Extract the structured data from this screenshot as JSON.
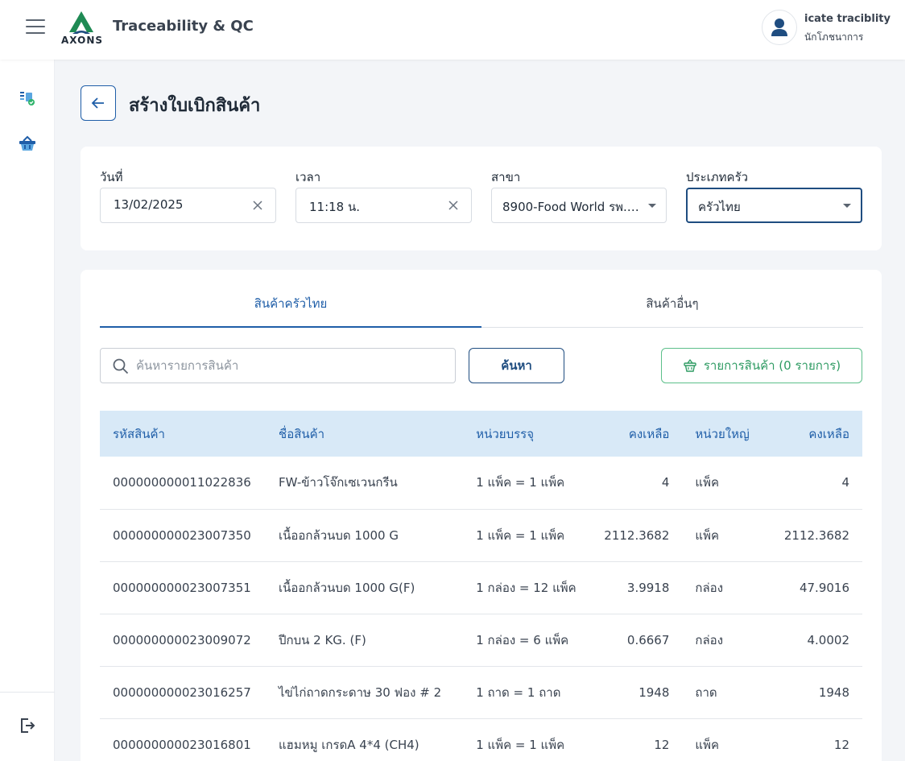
{
  "header": {
    "logo_text": "AXONS",
    "app_title": "Traceability & QC",
    "user_name": "icate traciblity",
    "user_role": "นักโภชนาการ"
  },
  "sidebar": {
    "items": [
      {
        "icon": "document-check-icon"
      },
      {
        "icon": "basket-icon"
      }
    ],
    "logout_icon": "logout-icon"
  },
  "page": {
    "title": "สร้างใบเบิกสินค้า"
  },
  "filters": {
    "date": {
      "label": "วันที่",
      "value": "13/02/2025"
    },
    "time": {
      "label": "เวลา",
      "value": "11:18 น."
    },
    "branch": {
      "label": "สาขา",
      "value": "8900-Food World รพ.…"
    },
    "kitchen_type": {
      "label": "ประเภทครัว",
      "value": "ครัวไทย"
    }
  },
  "tabs": [
    {
      "label": "สินค้าครัวไทย",
      "active": true
    },
    {
      "label": "สินค้าอื่นๆ",
      "active": false
    }
  ],
  "search": {
    "placeholder": "ค้นหารายการสินค้า",
    "button_label": "ค้นหา"
  },
  "cart": {
    "label": "รายการสินค้า (0 รายการ)"
  },
  "table": {
    "columns": [
      "รหัสสินค้า",
      "ชื่อสินค้า",
      "หน่วยบรรจุ",
      "คงเหลือ",
      "หน่วยใหญ่",
      "คงเหลือ"
    ],
    "rows": [
      {
        "code": "000000000011022836",
        "name": "FW-ข้าวโจ๊กเซเวนกรีน",
        "pack": "1 แพ็ค = 1 แพ็ค",
        "remain": "4",
        "unit": "แพ็ค",
        "remain_big": "4"
      },
      {
        "code": "000000000023007350",
        "name": "เนื้ออกล้วนบด 1000 G",
        "pack": "1 แพ็ค = 1 แพ็ค",
        "remain": "2112.3682",
        "unit": "แพ็ค",
        "remain_big": "2112.3682"
      },
      {
        "code": "000000000023007351",
        "name": "เนื้ออกล้วนบด 1000 G(F)",
        "pack": "1 กล่อง = 12 แพ็ค",
        "remain": "3.9918",
        "unit": "กล่อง",
        "remain_big": "47.9016"
      },
      {
        "code": "000000000023009072",
        "name": "ปีกบน 2 KG. (F)",
        "pack": "1 กล่อง = 6 แพ็ค",
        "remain": "0.6667",
        "unit": "กล่อง",
        "remain_big": "4.0002"
      },
      {
        "code": "000000000023016257",
        "name": "ไข่ไก่ถาดกระดาษ 30 ฟอง # 2",
        "pack": "1 ถาด = 1 ถาด",
        "remain": "1948",
        "unit": "ถาด",
        "remain_big": "1948"
      },
      {
        "code": "000000000023016801",
        "name": "แฮมหมู เกรดA 4*4 (CH4)",
        "pack": "1 แพ็ค = 1 แพ็ค",
        "remain": "12",
        "unit": "แพ็ค",
        "remain_big": "12"
      }
    ]
  },
  "colors": {
    "primary": "#1f5ea8",
    "header_row": "#d8e9f7",
    "success": "#2f9b63",
    "background": "#f3f5f8"
  }
}
